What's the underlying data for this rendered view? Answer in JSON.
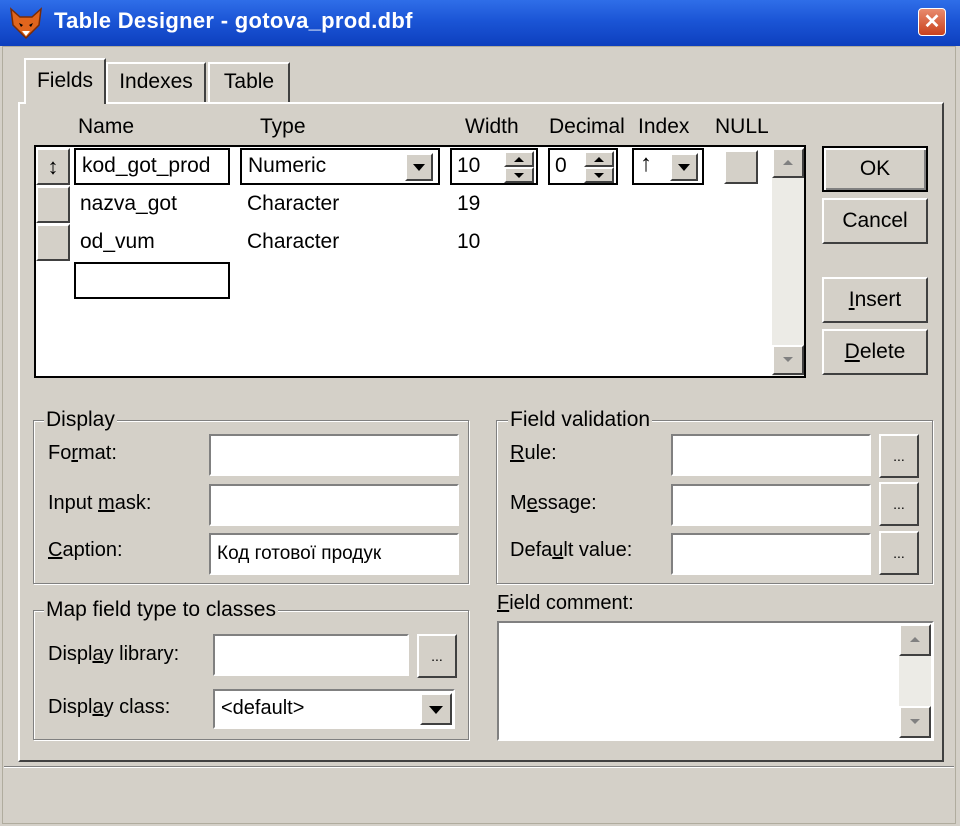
{
  "window": {
    "title": "Table Designer - gotova_prod.dbf",
    "close_glyph": "✕",
    "app_icon": "fox-icon"
  },
  "tabs": [
    {
      "label": "Fields",
      "active": true
    },
    {
      "label": "Indexes",
      "active": false
    },
    {
      "label": "Table",
      "active": false
    }
  ],
  "grid": {
    "columns": [
      "Name",
      "Type",
      "Width",
      "Decimal",
      "Index",
      "NULL"
    ],
    "selector_glyph": "↕",
    "rows": [
      {
        "name": "kod_got_prod",
        "type": "Numeric",
        "width": "10",
        "decimal": "0",
        "index_glyph": "↑"
      },
      {
        "name": "nazva_got",
        "type": "Character",
        "width": "19"
      },
      {
        "name": "od_vum",
        "type": "Character",
        "width": "10"
      }
    ],
    "new_row_name": ""
  },
  "buttons": {
    "ok": "OK",
    "cancel": "Cancel",
    "insert": {
      "pre": "",
      "key": "I",
      "post": "nsert"
    },
    "delete": {
      "pre": "",
      "key": "D",
      "post": "elete"
    }
  },
  "display": {
    "legend": "Display",
    "format": {
      "pre": "Fo",
      "key": "r",
      "post": "mat:",
      "value": ""
    },
    "input_mask": {
      "pre": "Input ",
      "key": "m",
      "post": "ask:",
      "value": ""
    },
    "caption": {
      "pre": "",
      "key": "C",
      "post": "aption:",
      "value": "Код готової продук"
    }
  },
  "validation": {
    "legend": "Field validation",
    "rule": {
      "pre": "",
      "key": "R",
      "post": "ule:",
      "value": ""
    },
    "message": {
      "pre": "M",
      "key": "e",
      "post": "ssage:",
      "value": ""
    },
    "default_value": {
      "pre": "Defa",
      "key": "u",
      "post": "lt value:",
      "value": ""
    },
    "ellipsis": "..."
  },
  "mapping": {
    "legend": "Map field type to classes",
    "library": {
      "pre": "Displ",
      "key": "a",
      "post": "y library:",
      "value": ""
    },
    "class": {
      "pre": "Displ",
      "key": "a",
      "post": "y class:",
      "value": "<default>"
    },
    "ellipsis": "..."
  },
  "comment": {
    "label": {
      "pre": "",
      "key": "F",
      "post": "ield comment:"
    },
    "value": ""
  }
}
